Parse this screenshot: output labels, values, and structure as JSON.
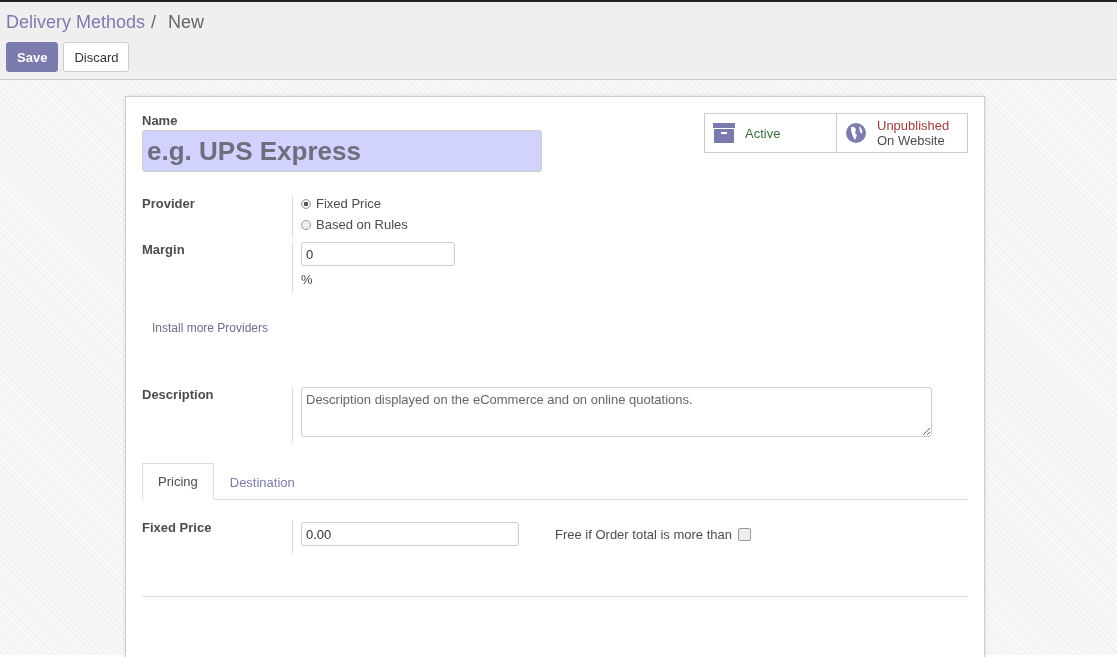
{
  "breadcrumb": {
    "parent": "Delivery Methods",
    "separator": "/",
    "current": "New"
  },
  "buttons": [
    {
      "label": "Save",
      "kind": "primary"
    },
    {
      "label": "Discard",
      "kind": "secondary"
    }
  ],
  "name": {
    "label": "Name",
    "placeholder": "e.g. UPS Express"
  },
  "status_buttons": [
    {
      "label": "Active",
      "kind": "archive"
    },
    {
      "label": "Unpublished",
      "sub": "On Website",
      "kind": "website"
    }
  ],
  "provider": {
    "label": "Provider",
    "options": [
      {
        "label": "Fixed Price",
        "selected": true
      },
      {
        "label": "Based on Rules",
        "selected": false
      }
    ]
  },
  "margin": {
    "label": "Margin",
    "value": "0",
    "unit": "%"
  },
  "install_link": "Install more Providers",
  "description": {
    "label": "Description",
    "placeholder": "Description displayed on the eCommerce and on online quotations."
  },
  "tabs": [
    {
      "label": "Pricing",
      "selected": true
    },
    {
      "label": "Destination",
      "selected": false
    }
  ],
  "fixed_price": {
    "label": "Fixed Price",
    "value": "0.00"
  },
  "free_if": {
    "label": "Free if Order total is more than",
    "checked": false
  }
}
